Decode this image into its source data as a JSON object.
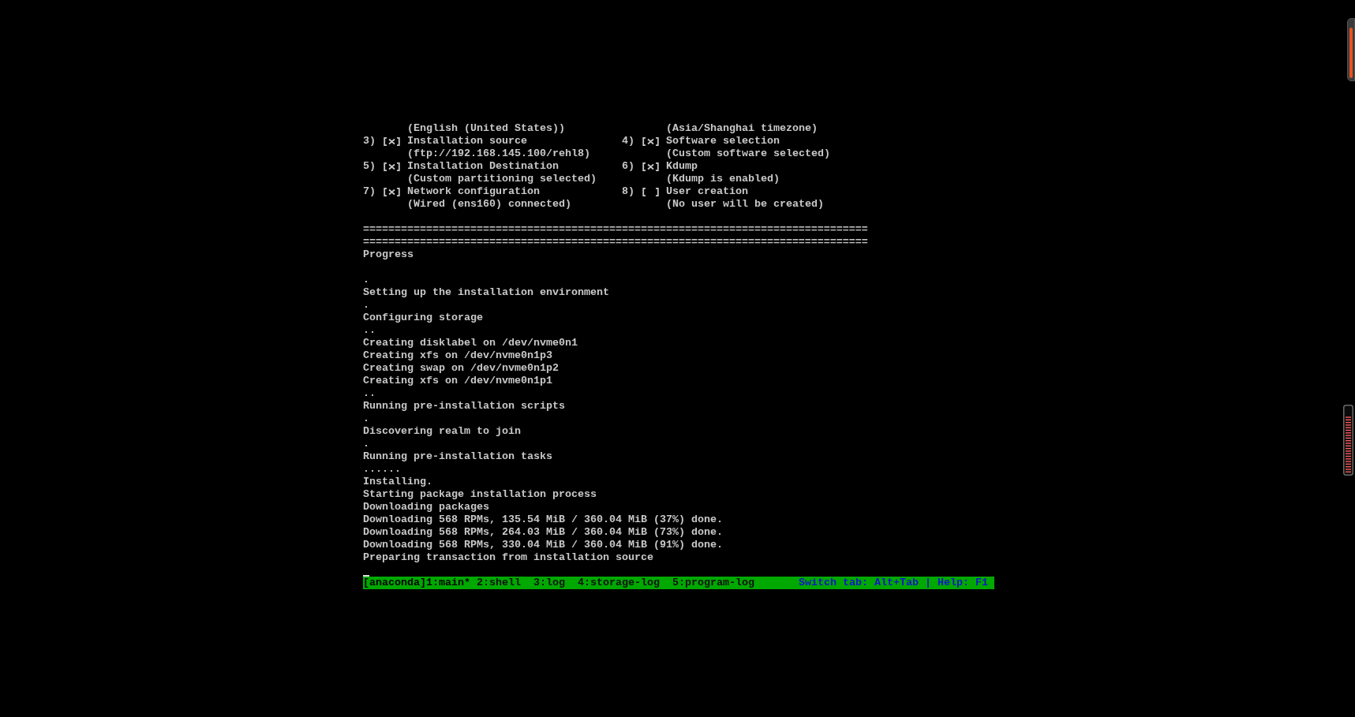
{
  "hub": {
    "cut_statuses": [
      "(English (United States))",
      "(Asia/Shanghai timezone)"
    ],
    "items": [
      {
        "number": "3)",
        "checked": true,
        "title": "Installation source",
        "status": "(ftp://192.168.145.100/rehl8)"
      },
      {
        "number": "4)",
        "checked": true,
        "title": "Software selection",
        "status": "(Custom software selected)"
      },
      {
        "number": "5)",
        "checked": true,
        "title": "Installation Destination",
        "status": "(Custom partitioning selected)"
      },
      {
        "number": "6)",
        "checked": true,
        "title": "Kdump",
        "status": "(Kdump is enabled)"
      },
      {
        "number": "7)",
        "checked": true,
        "title": "Network configuration",
        "status": "(Wired (ens160) connected)"
      },
      {
        "number": "8)",
        "checked": false,
        "title": "User creation",
        "status": "(No user will be created)"
      }
    ]
  },
  "separators": [
    "================================================================================",
    "================================================================================"
  ],
  "progress": {
    "title": "Progress",
    "log": [
      ".",
      "Setting up the installation environment",
      ".",
      "Configuring storage",
      "..",
      "Creating disklabel on /dev/nvme0n1",
      "Creating xfs on /dev/nvme0n1p3",
      "Creating swap on /dev/nvme0n1p2",
      "Creating xfs on /dev/nvme0n1p1",
      "..",
      "Running pre-installation scripts",
      ".",
      "Discovering realm to join",
      ".",
      "Running pre-installation tasks",
      "......",
      "Installing.",
      "Starting package installation process",
      "Downloading packages",
      "Downloading 568 RPMs, 135.54 MiB / 360.04 MiB (37%) done.",
      "Downloading 568 RPMs, 264.03 MiB / 360.04 MiB (73%) done.",
      "Downloading 568 RPMs, 330.04 MiB / 360.04 MiB (91%) done.",
      "Preparing transaction from installation source"
    ]
  },
  "status_bar": {
    "session": "[anaconda]",
    "windows": [
      {
        "label": "1:main*",
        "selected": true
      },
      {
        "label": "2:shell",
        "selected": false
      },
      {
        "label": "3:log",
        "selected": false
      },
      {
        "label": "4:storage-log",
        "selected": false
      },
      {
        "label": "5:program-log",
        "selected": false
      }
    ],
    "hint": "Switch tab: Alt+Tab | Help: F1"
  }
}
